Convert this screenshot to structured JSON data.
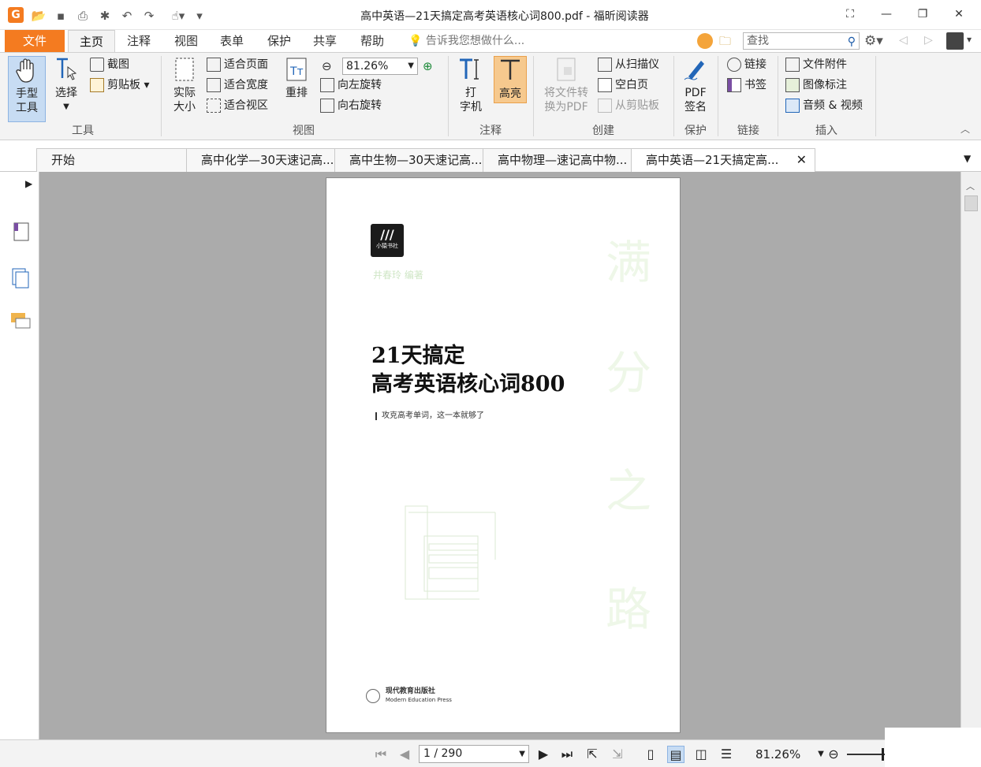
{
  "window": {
    "title": "高中英语—21天搞定高考英语核心词800.pdf - 福昕阅读器"
  },
  "tabs": {
    "file": "文件",
    "home": "主页",
    "comment": "注释",
    "view": "视图",
    "form": "表单",
    "protect": "保护",
    "share": "共享",
    "help": "帮助",
    "tell_me": "告诉我您想做什么..."
  },
  "search": {
    "placeholder": "查找"
  },
  "ribbon": {
    "tools": {
      "hand": "手型\n工具",
      "select": "选择",
      "snapshot": "截图",
      "clipboard": "剪贴板",
      "label": "工具"
    },
    "view": {
      "actual_size": "实际\n大小",
      "fit_page": "适合页面",
      "fit_width": "适合宽度",
      "fit_visible": "适合视区",
      "reflow": "重排",
      "zoom": "81.26%",
      "rotate_left": "向左旋转",
      "rotate_right": "向右旋转",
      "label": "视图"
    },
    "comment": {
      "typewriter": "打\n字机",
      "highlight": "高亮",
      "label": "注释"
    },
    "create": {
      "convert": "将文件转\n换为PDF",
      "from_scanner": "从扫描仪",
      "blank": "空白页",
      "from_clipboard": "从剪贴板",
      "label": "创建"
    },
    "protect": {
      "sign": "PDF\n签名",
      "label": "保护"
    },
    "links": {
      "link": "链接",
      "bookmark": "书签",
      "label": "链接"
    },
    "insert": {
      "attachment": "文件附件",
      "image": "图像标注",
      "media": "音频 & 视频",
      "label": "插入"
    }
  },
  "doc_tabs": [
    "开始",
    "高中化学—30天速记高...",
    "高中生物—30天速记高...",
    "高中物理—速记高中物...",
    "高中英语—21天搞定高..."
  ],
  "document": {
    "publisher_logo": "小猿书社",
    "author": "井春玲 编著",
    "side_text": [
      "满",
      "分",
      "之",
      "路"
    ],
    "title_line1": "21天搞定",
    "title_line2": "高考英语核心词800",
    "subtitle": "攻克高考单词，这一本就够了",
    "press_cn": "现代教育出版社",
    "press_en": "Modern Education Press"
  },
  "status": {
    "page": "1 / 290",
    "zoom": "81.26%"
  },
  "colors": {
    "accent": "#f47b20",
    "highlight_active": "#f6c98e",
    "hand_active": "#c7dcf3",
    "canvas": "#ababab"
  }
}
